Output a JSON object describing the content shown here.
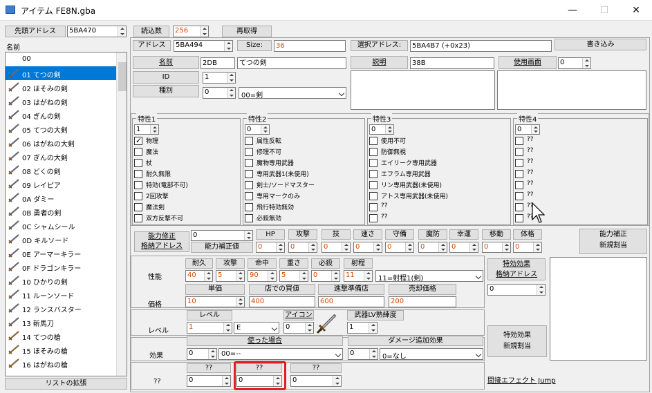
{
  "window": {
    "title": "アイテム FE8N.gba",
    "min": "—",
    "max": "☐",
    "close": "✕"
  },
  "top": {
    "base_addr_label": "先頭アドレス",
    "base_addr": "5BA470",
    "read_count_label": "読込数",
    "read_count": "256",
    "reload": "再取得",
    "addr_label": "アドレス",
    "addr": "5BA494",
    "size_label": "Size:",
    "size": "36",
    "sel_addr_label": "選択アドレス:",
    "sel_addr": "5BA4B7 (+0x23)",
    "write": "書き込み"
  },
  "list": {
    "header": "名前",
    "expand": "リストの拡張",
    "items": [
      {
        "label": "00",
        "icon": "none"
      },
      {
        "label": "01 てつの剣",
        "icon": "sword-icon"
      },
      {
        "label": "02 ほそみの剣",
        "icon": "sword-icon"
      },
      {
        "label": "03 はがねの剣",
        "icon": "sword-icon"
      },
      {
        "label": "04 ぎんの剣",
        "icon": "sword-icon"
      },
      {
        "label": "05 てつの大剣",
        "icon": "sword-icon"
      },
      {
        "label": "06 はがねの大剣",
        "icon": "sword-icon"
      },
      {
        "label": "07 ぎんの大剣",
        "icon": "sword-icon"
      },
      {
        "label": "08 どくの剣",
        "icon": "sword-icon"
      },
      {
        "label": "09 レイピア",
        "icon": "sword-icon"
      },
      {
        "label": "0A ダミー",
        "icon": "sword-icon"
      },
      {
        "label": "0B 勇者の剣",
        "icon": "sword-icon"
      },
      {
        "label": "0C シャムシール",
        "icon": "sword-icon"
      },
      {
        "label": "0D キルソード",
        "icon": "sword-icon"
      },
      {
        "label": "0E アーマーキラー",
        "icon": "sword-icon"
      },
      {
        "label": "0F ドラゴンキラー",
        "icon": "sword-icon"
      },
      {
        "label": "10 ひかりの剣",
        "icon": "sword-icon"
      },
      {
        "label": "11 ルーンソード",
        "icon": "sword-icon"
      },
      {
        "label": "12 ランスバスター",
        "icon": "sword-icon"
      },
      {
        "label": "13 斬馬刀",
        "icon": "sword-icon"
      },
      {
        "label": "14 てつの槍",
        "icon": "lance-icon"
      },
      {
        "label": "15 ほそみの槍",
        "icon": "lance-icon"
      },
      {
        "label": "16 はがねの槍",
        "icon": "lance-icon"
      }
    ]
  },
  "info": {
    "name_btn": "名前",
    "name_val": "2DB",
    "name_text": "てつの剣",
    "id_btn": "ID",
    "id_val": "1",
    "type_btn": "種別",
    "type_val": "0",
    "type_combo": "00=剣",
    "desc_btn": "説明",
    "desc_val": "38B",
    "use_btn": "使用画面",
    "use_val": "0"
  },
  "traits": [
    {
      "title": "特性1",
      "val": "1",
      "items": [
        {
          "l": "物理",
          "c": true
        },
        {
          "l": "魔法",
          "c": false
        },
        {
          "l": "杖",
          "c": false
        },
        {
          "l": "耐久無限",
          "c": false
        },
        {
          "l": "特効(竜部不可)",
          "c": false
        },
        {
          "l": "2回攻撃",
          "c": false
        },
        {
          "l": "魔法剣",
          "c": false
        },
        {
          "l": "双方反撃不可",
          "c": false
        }
      ]
    },
    {
      "title": "特性2",
      "val": "0",
      "items": [
        {
          "l": "属性反転",
          "c": false
        },
        {
          "l": "修理不可",
          "c": false
        },
        {
          "l": "魔物専用武器",
          "c": false
        },
        {
          "l": "専用武器1(未使用)",
          "c": false
        },
        {
          "l": "剣士/ソードマスター",
          "c": false
        },
        {
          "l": "専用マークのみ",
          "c": false
        },
        {
          "l": "飛行特効無効",
          "c": false
        },
        {
          "l": "必殺無効",
          "c": false
        }
      ]
    },
    {
      "title": "特性3",
      "val": "0",
      "items": [
        {
          "l": "使用不可",
          "c": false
        },
        {
          "l": "防御無視",
          "c": false
        },
        {
          "l": "エイリーク専用武器",
          "c": false
        },
        {
          "l": "エフラム専用武器",
          "c": false
        },
        {
          "l": "リン専用武器(未使用)",
          "c": false
        },
        {
          "l": "アトス専用武器(未使用)",
          "c": false
        },
        {
          "l": "??",
          "c": false
        },
        {
          "l": "??",
          "c": false
        }
      ]
    },
    {
      "title": "特性4",
      "val": "0",
      "items": [
        {
          "l": "??",
          "c": false
        },
        {
          "l": "??",
          "c": false
        },
        {
          "l": "??",
          "c": false
        },
        {
          "l": "??",
          "c": false
        },
        {
          "l": "??",
          "c": false
        },
        {
          "l": "??",
          "c": false
        },
        {
          "l": "??",
          "c": false
        },
        {
          "l": "??",
          "c": false
        }
      ]
    }
  ],
  "abil": {
    "btn1": "能力修正",
    "btn2": "格納アドレス",
    "addr": "0",
    "val_label": "能力補正値",
    "cols": [
      {
        "h": "HP",
        "v": "0"
      },
      {
        "h": "攻撃",
        "v": "0"
      },
      {
        "h": "技",
        "v": "0"
      },
      {
        "h": "速さ",
        "v": "0"
      },
      {
        "h": "守備",
        "v": "0"
      },
      {
        "h": "魔防",
        "v": "0"
      },
      {
        "h": "幸運",
        "v": "0"
      },
      {
        "h": "移動",
        "v": "0"
      },
      {
        "h": "体格",
        "v": "0"
      }
    ],
    "new1": "能力補正",
    "new2": "新規割当"
  },
  "perf": {
    "label": "性能",
    "cols": [
      {
        "h": "耐久",
        "v": "40"
      },
      {
        "h": "攻撃",
        "v": "5"
      },
      {
        "h": "命中",
        "v": "90"
      },
      {
        "h": "重さ",
        "v": "5"
      },
      {
        "h": "必殺",
        "v": "0"
      },
      {
        "h": "射程",
        "v": "11"
      }
    ],
    "range_combo": "11=射程1(剣)"
  },
  "price": {
    "label": "価格",
    "unit_h": "単価",
    "unit_v": "10",
    "shop_h": "店での買値",
    "shop_v": "400",
    "adv_h": "進撃準備店",
    "adv_v": "600",
    "sell_h": "売却価格",
    "sell_v": "200"
  },
  "level": {
    "label": "レベル",
    "lvl_h": "レベル",
    "lvl_v": "1",
    "rank": "E",
    "icon_btn": "アイコン",
    "icon_v": "0",
    "wexp_h": "武器LV熟練度",
    "wexp_v": "1"
  },
  "effect": {
    "label": "効果",
    "used_btn": "使った場合",
    "used_v": "0",
    "used_combo": "00=--",
    "dmg_h": "ダメージ追加効果",
    "dmg_v": "0",
    "dmg_combo": "0=なし"
  },
  "unk": {
    "label": "??",
    "h1": "??",
    "v1": "0",
    "h2": "??",
    "v2": "0",
    "h3": "??",
    "v3": "0"
  },
  "special": {
    "btn1": "特効効果",
    "btn2": "格納アドレス",
    "addr": "0",
    "new1": "特効効果",
    "new2": "新規割当",
    "jump": "間接エフェクト Jump"
  }
}
